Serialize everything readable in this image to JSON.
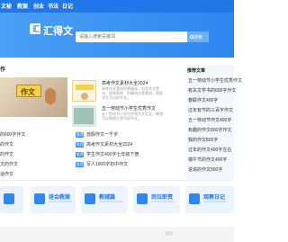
{
  "nav": {
    "items": [
      "文秘",
      "教案",
      "创业",
      "书法",
      "日记"
    ]
  },
  "brand": {
    "logo_mark": "汇",
    "name": "汇得文"
  },
  "search": {
    "placeholder": "请输入搜索关键词",
    "button": "搜索"
  },
  "left": {
    "section_title": "作",
    "sign_text": "作文",
    "articles": [
      {
        "title": "高考作文素材大全2024",
        "desc": "高考作文素材积累精选，包含名言警句、经典案例、时事热点等素材，帮助学生写出好作文。"
      },
      {
        "title": "五一劳动节小学生优秀作文",
        "desc": "五一劳动节小学生优秀作文范文，希望可以帮助大家写好作文。"
      }
    ],
    "list_left": [
      "的600字作文",
      "的作文",
      "的作文",
      "文的作文",
      "话作文"
    ],
    "tag": "推荐",
    "list_mid": [
      "放假作文一千字",
      "高考作文素材大全2024",
      "学生作文400字七年级下册",
      "写人1000字初中作文"
    ]
  },
  "right": {
    "title": "推荐文章",
    "items": [
      "五一劳动节小学生优秀作文",
      "有关文学书的600字作文",
      "春联作文400字",
      "过年有节的三百字作文",
      "五一劳动节作文400字",
      "有趣的作文800字作文",
      "我的作文800字",
      "过年的作文400字左右",
      "端午节的作文400字",
      "说说的作文800字",
      "写人作文400字"
    ]
  },
  "quick_links": [
    {
      "label": ""
    },
    {
      "label": "班会教案"
    },
    {
      "label": "教辅篇"
    },
    {
      "label": "岗位职责"
    },
    {
      "label": "观察日记"
    }
  ],
  "footer": {
    "text": "首页"
  }
}
